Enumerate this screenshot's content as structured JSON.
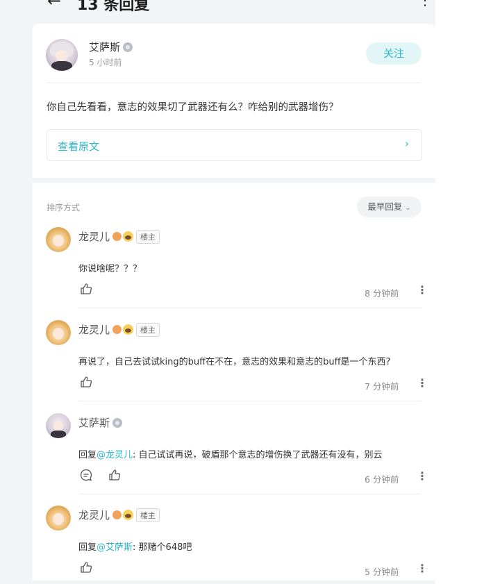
{
  "header": {
    "back_icon": "arrow-left-icon",
    "title": "13 条回复",
    "more_icon": "more-vertical-icon"
  },
  "original_post": {
    "author": "艾萨斯",
    "time": "5 小时前",
    "follow_label": "关注",
    "text": "你自己先看看，意志的效果切了武器还有么？咋给别的武器增伤？",
    "view_original_label": "查看原文",
    "view_original_chevron": "›"
  },
  "sort": {
    "label": "排序方式",
    "current": "最早回复"
  },
  "op_tag": "楼主",
  "replies": [
    {
      "author": "龙灵儿",
      "is_op": true,
      "prefix": "",
      "mention": "",
      "text": "你说啥呢？？？",
      "time": "8 分钟前"
    },
    {
      "author": "龙灵儿",
      "is_op": true,
      "prefix": "",
      "mention": "",
      "text": "再说了，自己去试试king的buff在不在，意志的效果和意志的buff是一个东西?",
      "time": "7 分钟前"
    },
    {
      "author": "艾萨斯",
      "is_op": false,
      "prefix": "回复",
      "mention": "@龙灵儿",
      "text": ": 自己试试再说，破盾那个意志的增伤换了武器还有没有，别云",
      "time": "6 分钟前"
    },
    {
      "author": "龙灵儿",
      "is_op": true,
      "prefix": "回复",
      "mention": "@艾萨斯",
      "text": ": 那赌个648吧",
      "time": "5 分钟前"
    }
  ],
  "colors": {
    "accent": "#2cb7c9",
    "follow_bg": "#e2f6f8",
    "page_bg": "#f3f4f5"
  }
}
